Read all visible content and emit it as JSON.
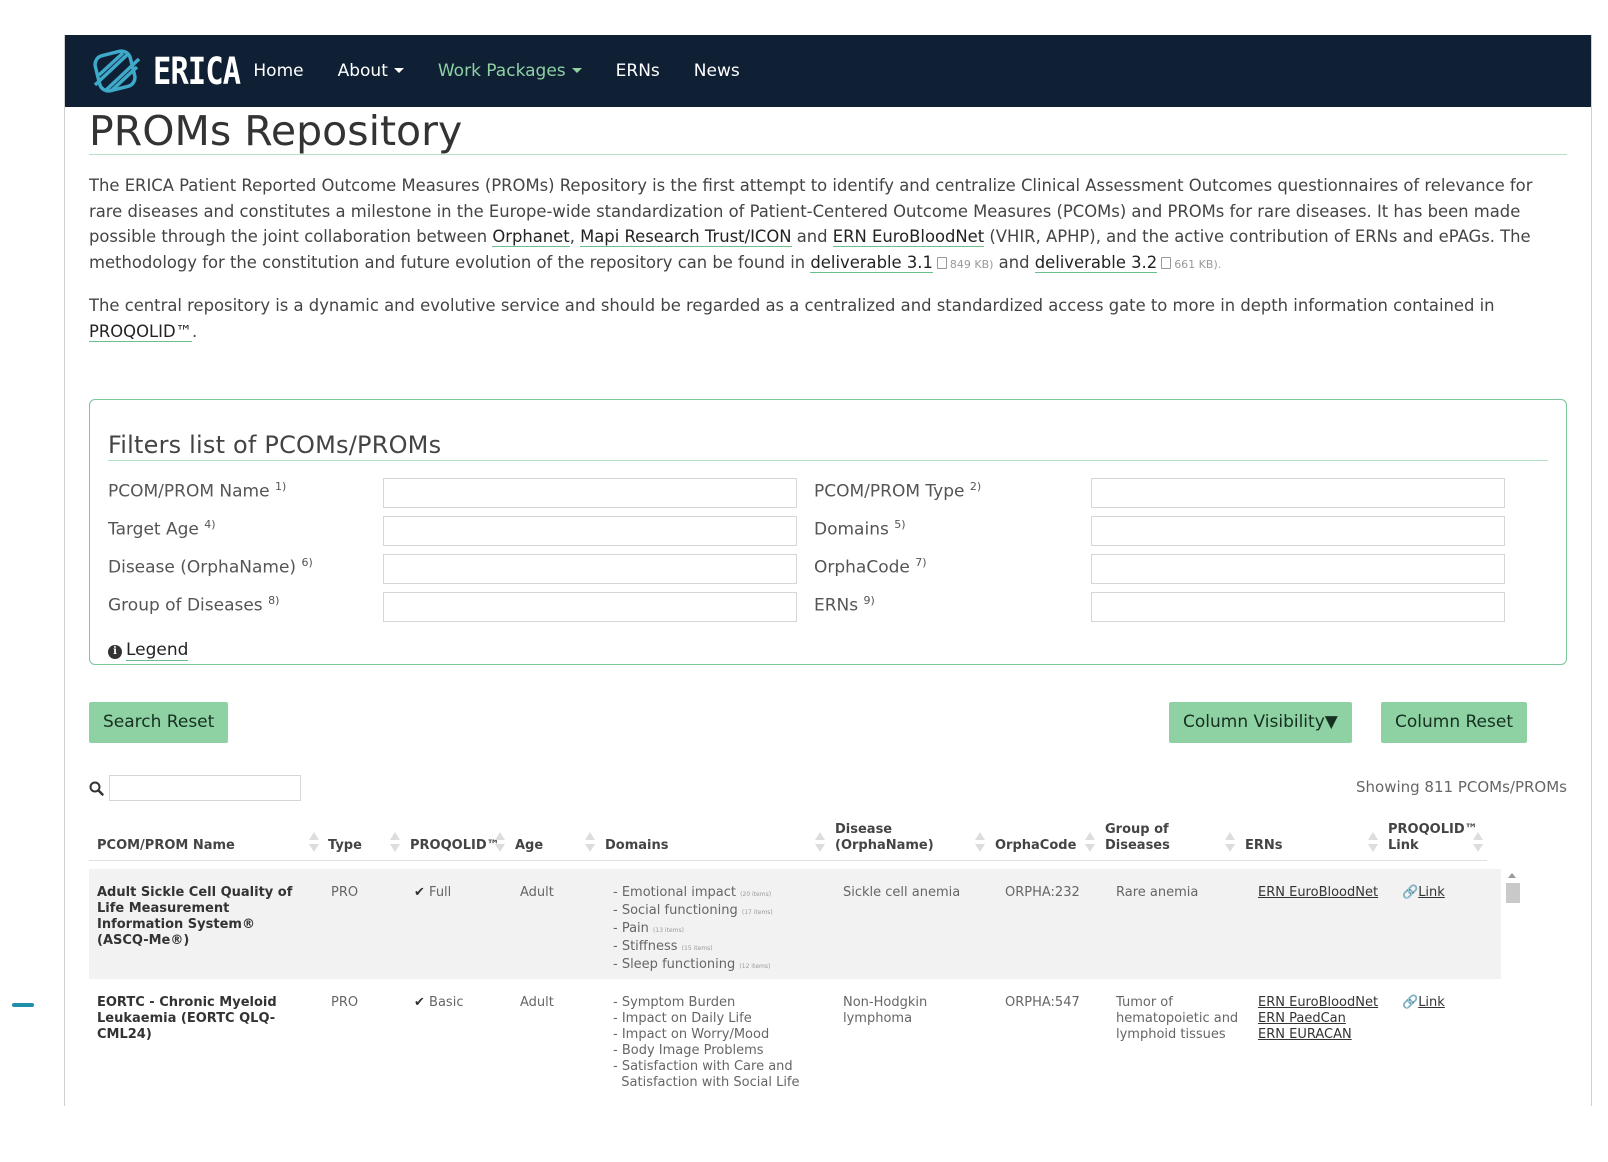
{
  "nav": {
    "brand": "ERICA",
    "links": [
      "Home",
      "About",
      "Work Packages",
      "ERNs",
      "News"
    ]
  },
  "page": {
    "title": "PROMs Repository",
    "intro": {
      "p1_a": "The ERICA Patient Reported Outcome Measures (PROMs) Repository is the first attempt to identify and centralize Clinical Assessment Outcomes questionnaires of relevance for rare diseases and constitutes a milestone in the Europe-wide standardization of Patient-Centered Outcome Measures (PCOMs) and PROMs for rare diseases. It has been made possible through the joint collaboration between ",
      "orphanet": "Orphanet",
      "comma": ", ",
      "mapi": "Mapi Research Trust/ICON",
      "and1": " and ",
      "ernebn": "ERN EuroBloodNet",
      "p1_b": " (VHIR, APHP), and the active contribution of ERNs and ePAGs. The methodology for the constitution and future evolution of the repository can be found in ",
      "deliverable1": "deliverable 3.1",
      "size1": "849 KB)",
      "and2": " and ",
      "deliverable2": "deliverable 3.2",
      "size2": "661 KB).",
      "p2": "The central repository is a dynamic and evolutive service and should be regarded as a centralized and standardized access gate to more in depth information contained in ",
      "proqolid": "PROQOLID™",
      "p2_end": "."
    }
  },
  "filters": {
    "title": "Filters list of PCOMs/PROMs",
    "fields": [
      {
        "label": "PCOM/PROM Name",
        "sup": "1)"
      },
      {
        "label": "PCOM/PROM Type",
        "sup": "2)"
      },
      {
        "label": "Target Age",
        "sup": "4)"
      },
      {
        "label": "Domains",
        "sup": "5)"
      },
      {
        "label": "Disease (OrphaName)",
        "sup": "6)"
      },
      {
        "label": "OrphaCode",
        "sup": "7)"
      },
      {
        "label": "Group of Diseases",
        "sup": "8)"
      },
      {
        "label": "ERNs",
        "sup": "9)"
      }
    ],
    "legend": "Legend"
  },
  "buttons": {
    "search_reset": "Search Reset",
    "column_visibility": "Column Visibility▼",
    "column_reset": "Column Reset"
  },
  "table": {
    "showing": "Showing 811 PCOMs/PROMs",
    "headers": {
      "name": "PCOM/PROM Name",
      "type": "Type",
      "proqolid": "PROQOLID™",
      "age": "Age",
      "domains": "Domains",
      "disease_1": "Disease",
      "disease_2": "(OrphaName)",
      "orphacode": "OrphaCode",
      "group_1": "Group of",
      "group_2": "Diseases",
      "erns": "ERNs",
      "link_1": "PROQOLID™",
      "link_2": "Link"
    },
    "rows": [
      {
        "name": "Adult Sickle Cell Quality of Life Measurement Information System® (ASCQ-Me®)",
        "type": "PRO",
        "proqolid": "Full",
        "age": "Adult",
        "domains": [
          {
            "text": "- Emotional impact",
            "items": "(20 items)"
          },
          {
            "text": "- Social functioning",
            "items": "(17 items)"
          },
          {
            "text": "- Pain",
            "items": "(13 items)"
          },
          {
            "text": "- Stiffness",
            "items": "(15 items)"
          },
          {
            "text": "- Sleep functioning",
            "items": "(12 items)"
          }
        ],
        "disease": "Sickle cell anemia",
        "orphacode": "ORPHA:232",
        "group": "Rare anemia",
        "erns": [
          "ERN EuroBloodNet"
        ],
        "link": "Link"
      },
      {
        "name": "EORTC - Chronic Myeloid Leukaemia (EORTC QLQ-CML24)",
        "type": "PRO",
        "proqolid": "Basic",
        "age": "Adult",
        "domains": [
          {
            "text": "- Symptom Burden",
            "items": ""
          },
          {
            "text": "- Impact on Daily Life",
            "items": ""
          },
          {
            "text": "- Impact on Worry/Mood",
            "items": ""
          },
          {
            "text": "- Body Image Problems",
            "items": ""
          },
          {
            "text": "- Satisfaction with Care and",
            "items": ""
          },
          {
            "text": "  Satisfaction with Social Life",
            "items": ""
          }
        ],
        "disease": "Non-Hodgkin lymphoma",
        "orphacode": "ORPHA:547",
        "group": "Tumor of hematopoietic and lymphoid tissues",
        "erns": [
          "ERN EuroBloodNet",
          "ERN PaedCan",
          "ERN EURACAN"
        ],
        "link": "Link"
      }
    ]
  },
  "colors": {
    "navbar": "#0f2035",
    "accent": "#8ed1a3",
    "border": "#7bc797"
  }
}
